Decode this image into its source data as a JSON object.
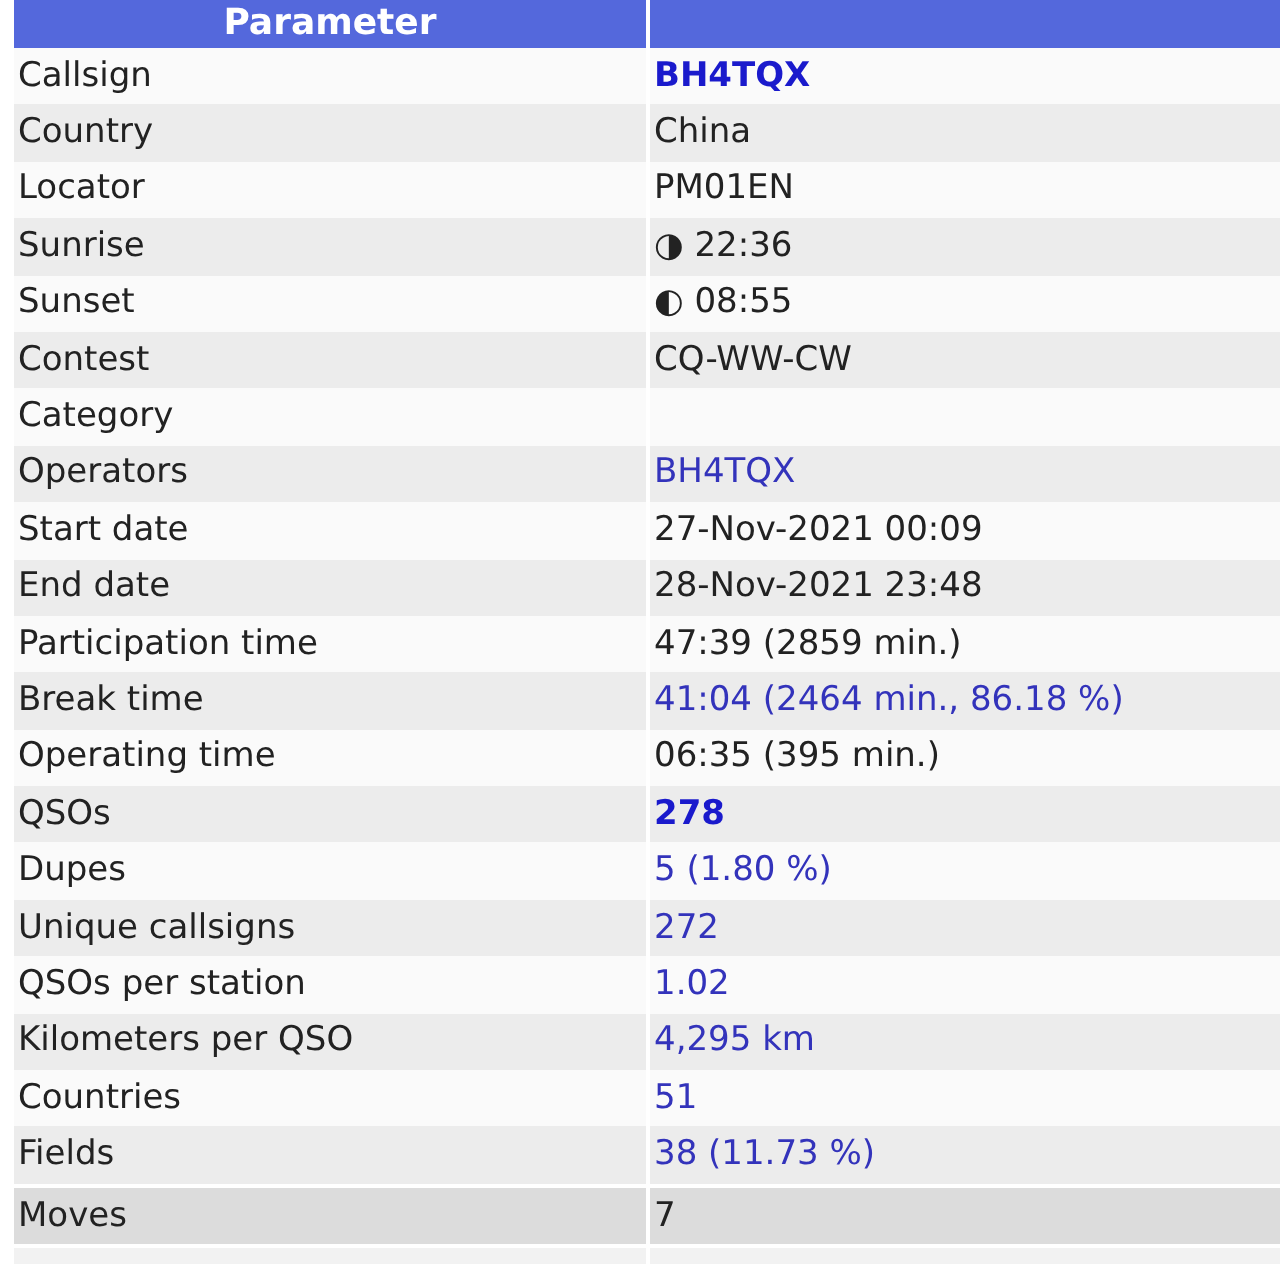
{
  "table": {
    "columns": [
      "Parameter"
    ],
    "rows": [
      {
        "label": "Callsign",
        "value": "BH4TQX",
        "kind": "strong",
        "highlighted": false
      },
      {
        "label": "Country",
        "value": "China",
        "kind": "text",
        "highlighted": false
      },
      {
        "label": "Locator",
        "value": "PM01EN",
        "kind": "text",
        "highlighted": false
      },
      {
        "label": "Sunrise",
        "value": "◑ 22:36",
        "kind": "text",
        "highlighted": false
      },
      {
        "label": "Sunset",
        "value": "◐ 08:55",
        "kind": "text",
        "highlighted": false
      },
      {
        "label": "Contest",
        "value": "CQ-WW-CW",
        "kind": "text",
        "highlighted": false
      },
      {
        "label": "Category",
        "highlighted": false
      },
      {
        "label": "Operators",
        "value": "BH4TQX",
        "kind": "link",
        "highlighted": false
      },
      {
        "label": "Start date",
        "value": "27-Nov-2021 00:09",
        "kind": "text",
        "highlighted": false
      },
      {
        "label": "End date",
        "value": "28-Nov-2021 23:48",
        "kind": "text",
        "highlighted": false
      },
      {
        "label": "Participation time",
        "value": "47:39 (2859 min.)",
        "kind": "text",
        "highlighted": false
      },
      {
        "label": "Break time",
        "value": "41:04 (2464 min., 86.18 %)",
        "kind": "link",
        "highlighted": false
      },
      {
        "label": "Operating time",
        "value": "06:35 (395 min.)",
        "kind": "text",
        "highlighted": false
      },
      {
        "label": "QSOs",
        "value": "278",
        "kind": "strong",
        "highlighted": false
      },
      {
        "label": "Dupes",
        "value": "5 (1.80 %)",
        "kind": "link",
        "highlighted": false
      },
      {
        "label": "Unique callsigns",
        "value": "272",
        "kind": "link",
        "highlighted": false
      },
      {
        "label": "QSOs per station",
        "value": "1.02",
        "kind": "link",
        "highlighted": false
      },
      {
        "label": "Kilometers per QSO",
        "value": "4,295 km",
        "kind": "link",
        "highlighted": false
      },
      {
        "label": "Countries",
        "value": "51",
        "kind": "link",
        "highlighted": false
      },
      {
        "label": "Fields",
        "value": "38 (11.73 %)",
        "kind": "link",
        "highlighted": false
      },
      {
        "label": "Moves",
        "value": "7",
        "kind": "text",
        "highlighted": true
      }
    ]
  }
}
